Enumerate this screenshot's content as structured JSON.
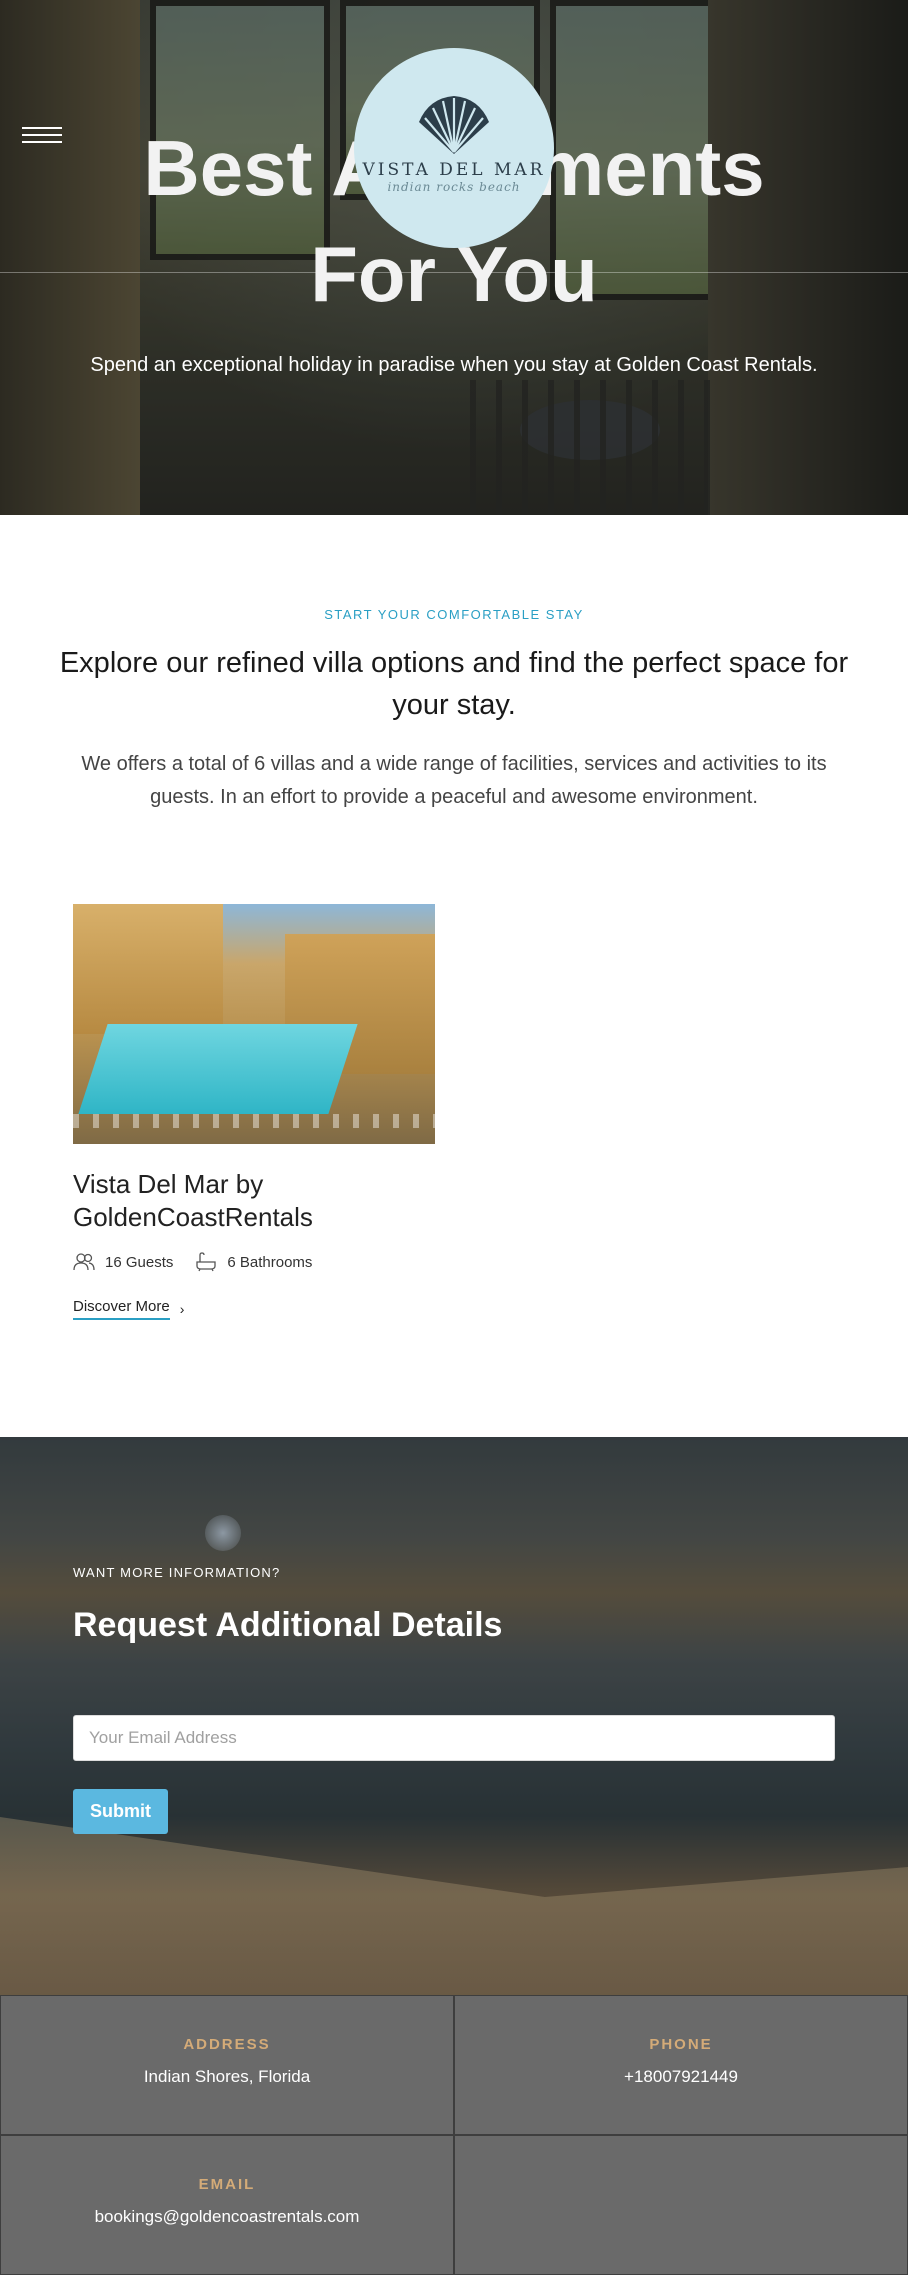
{
  "hero": {
    "title_line1": "Best Apartments",
    "title_line2": "For You",
    "subtitle": "Spend an exceptional holiday in paradise when you stay at Golden Coast Rentals.",
    "logo": {
      "brand": "VISTA DEL MAR",
      "tagline": "indian rocks beach"
    }
  },
  "intro": {
    "eyebrow": "START YOUR COMFORTABLE STAY",
    "heading": "Explore our refined villa options and find the perfect space for your stay.",
    "text": "We offers a total of 6 villas and a wide range of facilities, services and activities to its guests. In an effort to provide a peaceful and awesome environment."
  },
  "listing": {
    "title": "Vista Del Mar by GoldenCoastRentals",
    "guests": "16 Guests",
    "bathrooms": "6 Bathrooms",
    "link": "Discover More"
  },
  "cta": {
    "eyebrow": "WANT MORE INFORMATION?",
    "heading": "Request Additional Details",
    "email_placeholder": "Your Email Address",
    "submit": "Submit"
  },
  "contact": {
    "address_label": "ADDRESS",
    "address": "Indian Shores, Florida",
    "phone_label": "PHONE",
    "phone": "+18007921449",
    "email_label": "EMAIL",
    "email": "bookings@goldencoastrentals.com"
  },
  "colors": {
    "accent": "#2a9fc4",
    "button": "#5bb8e0",
    "label_gold": "#d4ab78",
    "footer_bg": "#6a6a6a"
  }
}
